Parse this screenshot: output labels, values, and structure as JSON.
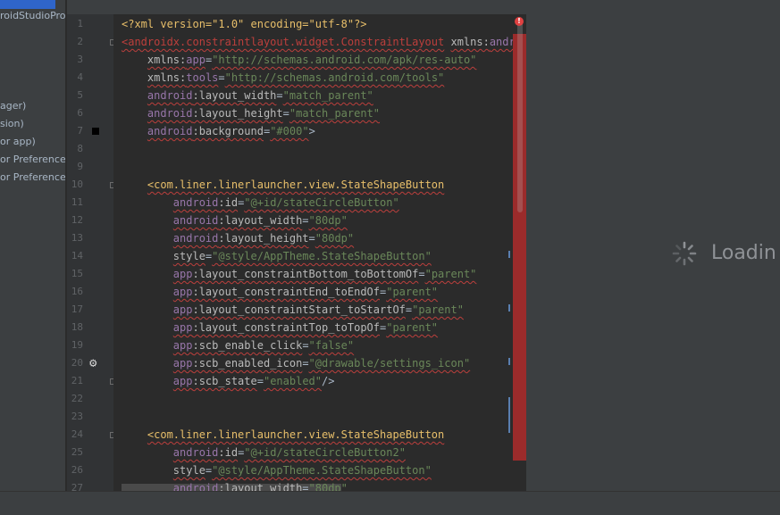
{
  "project_panel": {
    "items": [
      "roidStudioProj",
      "ager)",
      "sion)",
      "or app)",
      "or PreferenceM",
      "or PreferenceM"
    ]
  },
  "editor": {
    "line_numbers": [
      "1",
      "2",
      "3",
      "4",
      "5",
      "6",
      "7",
      "8",
      "9",
      "10",
      "11",
      "12",
      "13",
      "14",
      "15",
      "16",
      "17",
      "18",
      "19",
      "20",
      "21",
      "22",
      "23",
      "24",
      "25",
      "26",
      "27"
    ],
    "lines": [
      {
        "n": 1,
        "segments": [
          [
            "pi",
            "<?xml version=\"1.0\" encoding=\"utf-8\"?>"
          ]
        ]
      },
      {
        "n": 2,
        "squiggle": true,
        "segments": [
          [
            "err",
            "<androidx.constraintlayout.widget.ConstraintLayout"
          ],
          [
            "p",
            " "
          ],
          [
            "attr",
            "xmlns:"
          ],
          [
            "ns",
            "android"
          ]
        ]
      },
      {
        "n": 3,
        "squiggle": true,
        "segments": [
          [
            "p",
            "    "
          ],
          [
            "attr",
            "xmlns:"
          ],
          [
            "ns",
            "app"
          ],
          [
            "p",
            "="
          ],
          [
            "str",
            "\"http://schemas.android.com/apk/res-auto\""
          ]
        ]
      },
      {
        "n": 4,
        "squiggle": true,
        "segments": [
          [
            "p",
            "    "
          ],
          [
            "attr",
            "xmlns:"
          ],
          [
            "ns",
            "tools"
          ],
          [
            "p",
            "="
          ],
          [
            "str",
            "\"http://schemas.android.com/tools\""
          ]
        ]
      },
      {
        "n": 5,
        "squiggle": true,
        "segments": [
          [
            "p",
            "    "
          ],
          [
            "ns",
            "android"
          ],
          [
            "attr",
            ":layout_width"
          ],
          [
            "p",
            "="
          ],
          [
            "str",
            "\"match_parent\""
          ]
        ]
      },
      {
        "n": 6,
        "squiggle": true,
        "segments": [
          [
            "p",
            "    "
          ],
          [
            "ns",
            "android"
          ],
          [
            "attr",
            ":layout_height"
          ],
          [
            "p",
            "="
          ],
          [
            "str",
            "\"match_parent\""
          ]
        ]
      },
      {
        "n": 7,
        "squiggle": true,
        "segments": [
          [
            "p",
            "    "
          ],
          [
            "ns",
            "android"
          ],
          [
            "attr",
            ":background"
          ],
          [
            "p",
            "="
          ],
          [
            "str",
            "\"#000\""
          ],
          [
            "p",
            ">"
          ]
        ]
      },
      {
        "n": 8,
        "segments": []
      },
      {
        "n": 9,
        "segments": []
      },
      {
        "n": 10,
        "squiggle": true,
        "segments": [
          [
            "p",
            "    "
          ],
          [
            "tag",
            "<com.liner.linerlauncher.view.StateShapeButton"
          ]
        ]
      },
      {
        "n": 11,
        "squiggle": true,
        "segments": [
          [
            "p",
            "        "
          ],
          [
            "ns",
            "android"
          ],
          [
            "attr",
            ":id"
          ],
          [
            "p",
            "="
          ],
          [
            "str",
            "\"@+id/stateCircleButton\""
          ]
        ]
      },
      {
        "n": 12,
        "squiggle": true,
        "segments": [
          [
            "p",
            "        "
          ],
          [
            "ns",
            "android"
          ],
          [
            "attr",
            ":layout_width"
          ],
          [
            "p",
            "="
          ],
          [
            "str",
            "\"80dp\""
          ]
        ]
      },
      {
        "n": 13,
        "squiggle": true,
        "segments": [
          [
            "p",
            "        "
          ],
          [
            "ns",
            "android"
          ],
          [
            "attr",
            ":layout_height"
          ],
          [
            "p",
            "="
          ],
          [
            "str",
            "\"80dp\""
          ]
        ]
      },
      {
        "n": 14,
        "squiggle": true,
        "segments": [
          [
            "p",
            "        "
          ],
          [
            "attr",
            "style"
          ],
          [
            "p",
            "="
          ],
          [
            "str",
            "\"@style/AppTheme.StateShapeButton\""
          ]
        ]
      },
      {
        "n": 15,
        "squiggle": true,
        "segments": [
          [
            "p",
            "        "
          ],
          [
            "ns",
            "app"
          ],
          [
            "attr",
            ":layout_constraintBottom_toBottomOf"
          ],
          [
            "p",
            "="
          ],
          [
            "str",
            "\"parent\""
          ]
        ]
      },
      {
        "n": 16,
        "squiggle": true,
        "segments": [
          [
            "p",
            "        "
          ],
          [
            "ns",
            "app"
          ],
          [
            "attr",
            ":layout_constraintEnd_toEndOf"
          ],
          [
            "p",
            "="
          ],
          [
            "str",
            "\"parent\""
          ]
        ]
      },
      {
        "n": 17,
        "squiggle": true,
        "segments": [
          [
            "p",
            "        "
          ],
          [
            "ns",
            "app"
          ],
          [
            "attr",
            ":layout_constraintStart_toStartOf"
          ],
          [
            "p",
            "="
          ],
          [
            "str",
            "\"parent\""
          ]
        ]
      },
      {
        "n": 18,
        "squiggle": true,
        "segments": [
          [
            "p",
            "        "
          ],
          [
            "ns",
            "app"
          ],
          [
            "attr",
            ":layout_constraintTop_toTopOf"
          ],
          [
            "p",
            "="
          ],
          [
            "str",
            "\"parent\""
          ]
        ]
      },
      {
        "n": 19,
        "squiggle": true,
        "segments": [
          [
            "p",
            "        "
          ],
          [
            "ns",
            "app"
          ],
          [
            "attr",
            ":scb_enable_click"
          ],
          [
            "p",
            "="
          ],
          [
            "str",
            "\"false\""
          ]
        ]
      },
      {
        "n": 20,
        "squiggle": true,
        "segments": [
          [
            "p",
            "        "
          ],
          [
            "ns",
            "app"
          ],
          [
            "attr",
            ":scb_enabled_icon"
          ],
          [
            "p",
            "="
          ],
          [
            "str",
            "\"@drawable/settings_icon\""
          ]
        ]
      },
      {
        "n": 21,
        "squiggle": true,
        "segments": [
          [
            "p",
            "        "
          ],
          [
            "ns",
            "app"
          ],
          [
            "attr",
            ":scb_state"
          ],
          [
            "p",
            "="
          ],
          [
            "str",
            "\"enabled\""
          ],
          [
            "p",
            "/>"
          ]
        ]
      },
      {
        "n": 22,
        "segments": []
      },
      {
        "n": 23,
        "segments": []
      },
      {
        "n": 24,
        "squiggle": true,
        "segments": [
          [
            "p",
            "    "
          ],
          [
            "tag",
            "<com.liner.linerlauncher.view.StateShapeButton"
          ]
        ]
      },
      {
        "n": 25,
        "squiggle": true,
        "segments": [
          [
            "p",
            "        "
          ],
          [
            "ns",
            "android"
          ],
          [
            "attr",
            ":id"
          ],
          [
            "p",
            "="
          ],
          [
            "str",
            "\"@+id/stateCircleButton2\""
          ]
        ]
      },
      {
        "n": 26,
        "squiggle": true,
        "segments": [
          [
            "p",
            "        "
          ],
          [
            "attr",
            "style"
          ],
          [
            "p",
            "="
          ],
          [
            "str",
            "\"@style/AppTheme.StateShapeButton\""
          ]
        ]
      },
      {
        "n": 27,
        "squiggle": true,
        "segments": [
          [
            "p",
            "        "
          ],
          [
            "ns",
            "android"
          ],
          [
            "attr",
            ":layout_width"
          ],
          [
            "p",
            "="
          ],
          [
            "str",
            "\"80dp\""
          ]
        ]
      }
    ]
  },
  "gutter_icons": {
    "color_swatch": {
      "line": 7,
      "color": "#000000"
    },
    "gear": {
      "line": 20,
      "icon": "gear-icon"
    }
  },
  "error_indicator": {
    "icon": "error-icon",
    "glyph": "!"
  },
  "preview": {
    "loading_text": "Loadin",
    "spinner_icon": "spinner-icon"
  },
  "colors": {
    "editor_bg": "#2b2b2b",
    "gutter_bg": "#313335",
    "panel_bg": "#3c3f41",
    "error_stripe": "#9b2b2b",
    "tag": "#e8bf6a",
    "string": "#6a8759",
    "namespace": "#9876aa",
    "error_text": "#bc3f3c"
  }
}
